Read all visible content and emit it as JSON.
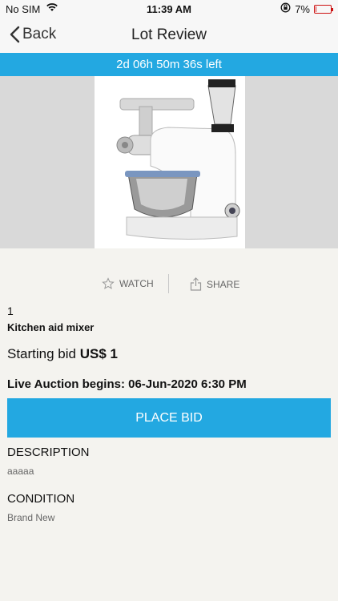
{
  "status_bar": {
    "carrier": "No SIM",
    "time": "11:39 AM",
    "battery": "7%",
    "battery_level": 0.07
  },
  "nav": {
    "back_label": "Back",
    "title": "Lot Review"
  },
  "timer": {
    "text": "2d 06h 50m 36s left"
  },
  "actions": {
    "watch_label": "WATCH",
    "share_label": "SHARE"
  },
  "lot": {
    "number": "1",
    "title": "Kitchen aid mixer",
    "starting_bid_label": "Starting bid",
    "starting_bid_value": "US$ 1",
    "live_auction": "Live Auction begins: 06-Jun-2020 6:30 PM"
  },
  "place_bid_label": "PLACE BID",
  "description": {
    "title": "DESCRIPTION",
    "text": "aaaaa"
  },
  "condition": {
    "title": "CONDITION",
    "text": "Brand New"
  },
  "colors": {
    "accent": "#23a8e1",
    "background": "#f4f3ef",
    "battery": "#d22"
  }
}
